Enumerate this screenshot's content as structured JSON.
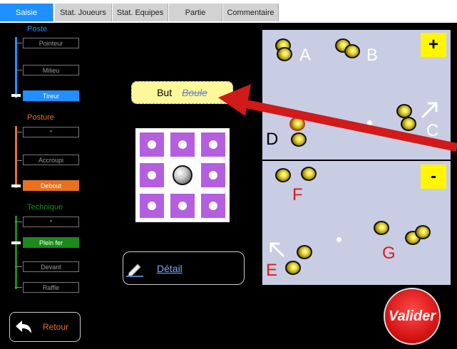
{
  "tabs": [
    {
      "label": "Saisie"
    },
    {
      "label": "Stat. Joueurs"
    },
    {
      "label": "Stat. Equipes"
    },
    {
      "label": "Partie"
    },
    {
      "label": "Commentaire"
    }
  ],
  "sidebar": {
    "poste": {
      "title": "Poste",
      "options": [
        "Pointeur",
        "Milieu",
        "Tireur"
      ],
      "selected": "Tireur"
    },
    "posture": {
      "title": "Posture",
      "options": [
        "*",
        "Accroupi",
        "Debout"
      ],
      "selected": "Debout"
    },
    "technique": {
      "title": "Technique",
      "options": [
        "*",
        "Plein fer",
        "Devant",
        "Raffle"
      ],
      "selected": "Plein fer"
    }
  },
  "target": {
    "but": "But",
    "boule": "Boule"
  },
  "detail_label": "Détail",
  "panels": {
    "top": {
      "button": "+",
      "letters": [
        "A",
        "B",
        "C",
        "D"
      ]
    },
    "bottom": {
      "button": "-",
      "letters": [
        "F",
        "G",
        "E"
      ]
    }
  },
  "retour_label": "Retour",
  "valider_label": "Valider",
  "colors": {
    "tab_active": "#1e90ff",
    "poste": "#1e90ff",
    "posture": "#e8711f",
    "technique": "#1b8a1b",
    "arrow": "#d11a1a"
  }
}
